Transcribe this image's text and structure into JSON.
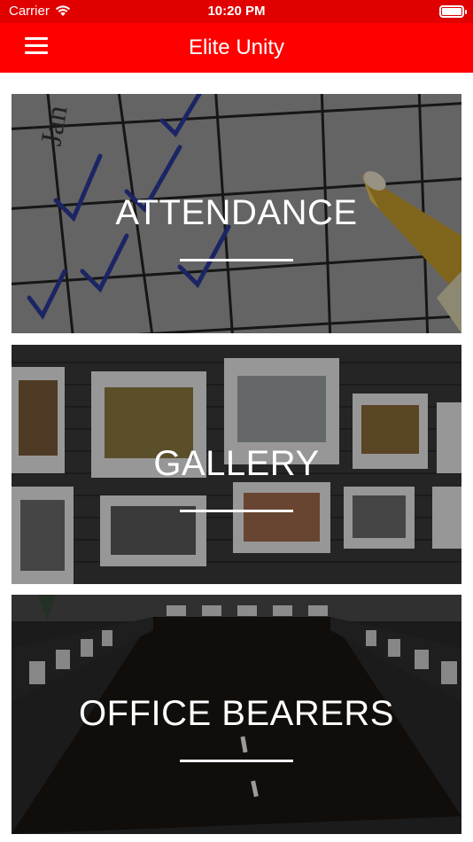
{
  "status_bar": {
    "carrier": "Carrier",
    "time": "10:20 PM"
  },
  "app_bar": {
    "title": "Elite Unity",
    "menu_icon": "hamburger-menu-icon",
    "background_color": "#ff0000"
  },
  "tiles": [
    {
      "label": "ATTENDANCE"
    },
    {
      "label": "GALLERY"
    },
    {
      "label": "OFFICE BEARERS"
    }
  ]
}
